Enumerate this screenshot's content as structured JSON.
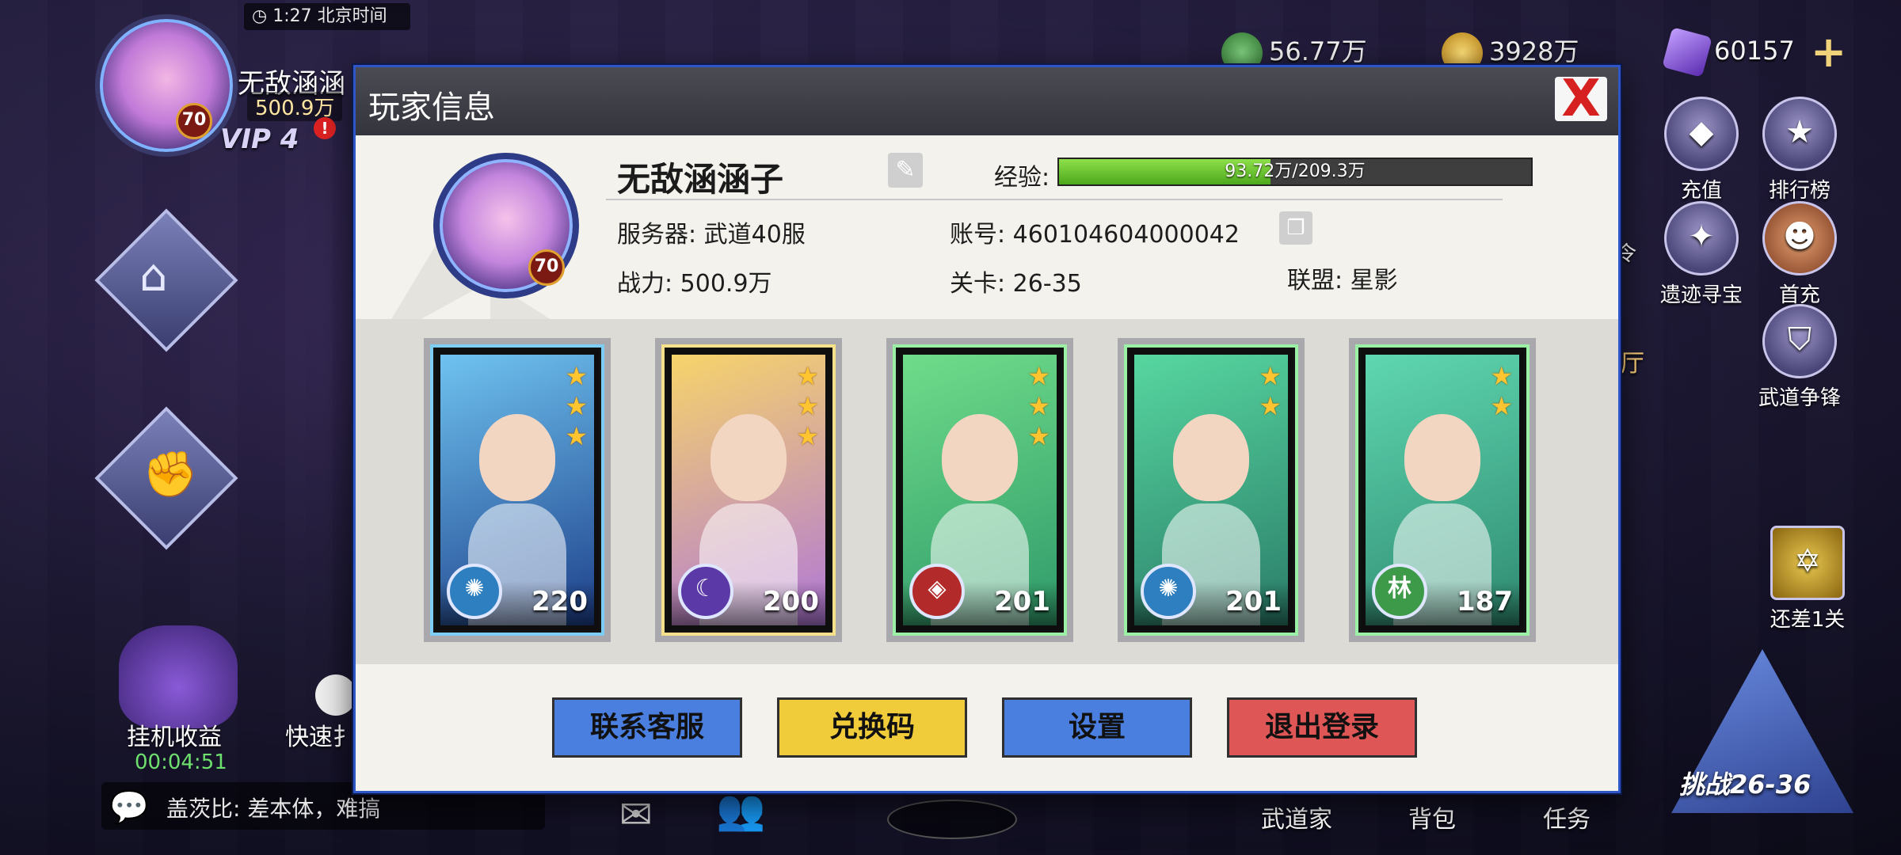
{
  "hud": {
    "time": "1:27 北京时间",
    "player_name": "无敌涵涵",
    "power": "500.9万",
    "level": "70",
    "vip": "VIP 4",
    "alert": "!",
    "currencies": [
      {
        "icon": "spiral-coin-icon",
        "value": "56.77万",
        "color": "#4aa04a"
      },
      {
        "icon": "gold-coin-icon",
        "value": "3928万",
        "color": "#d9a020"
      },
      {
        "icon": "purple-gem-icon",
        "value": "60157",
        "color": "#8a5ad8"
      }
    ],
    "add": "+",
    "right_buttons": [
      "充值",
      "排行榜",
      "遗迹寻宝",
      "首充",
      "武道争锋",
      "还差1关"
    ],
    "partial_left_labels": [
      "令",
      "厅"
    ],
    "left_bottom": {
      "idle": "挂机收益",
      "idle_timer": "00:04:51",
      "quick": "快速扌"
    },
    "chat": {
      "speaker": "盖茨比",
      "message": "差本体，难搞",
      "line": "盖茨比: 差本体，难搞"
    },
    "bottom_nav": [
      "武道家",
      "背包",
      "任务"
    ],
    "challenge": "挑战26-36"
  },
  "modal": {
    "title": "玩家信息",
    "close": "X",
    "player": {
      "name": "无敌涵涵子",
      "level": "70",
      "exp_label": "经验:",
      "exp_text": "93.72万/209.3万",
      "exp_fraction": 0.448,
      "server_label": "服务器:",
      "server": "武道40服",
      "account_label": "账号:",
      "account": "460104604000042",
      "power_label": "战力:",
      "power": "500.9万",
      "stage_label": "关卡:",
      "stage": "26-35",
      "alliance_label": "联盟:",
      "alliance": "星影"
    },
    "team": [
      {
        "level": "220",
        "stars": 3,
        "element": "wind-swirl-icon",
        "element_glyph": "✺",
        "element_color": "#2e7fc0",
        "bg": [
          "#6fc3f0",
          "#1d3f8a"
        ],
        "frame": "blue"
      },
      {
        "level": "200",
        "stars": 3,
        "element": "moon-icon",
        "element_glyph": "☾",
        "element_color": "#5b3aa8",
        "bg": [
          "#f7d46a",
          "#b077d8"
        ],
        "frame": "gold"
      },
      {
        "level": "201",
        "stars": 3,
        "element": "fire-icon",
        "element_glyph": "◈",
        "element_color": "#b22a2a",
        "bg": [
          "#6fdc8a",
          "#2f9a6a"
        ],
        "frame": "green"
      },
      {
        "level": "201",
        "stars": 2,
        "element": "wind-swirl-icon",
        "element_glyph": "✺",
        "element_color": "#2e7fc0",
        "bg": [
          "#57d7a0",
          "#2a7c68"
        ],
        "frame": "green"
      },
      {
        "level": "187",
        "stars": 2,
        "element": "forest-icon",
        "element_glyph": "林",
        "element_color": "#3c9a48",
        "bg": [
          "#5fd7b0",
          "#2f8a70"
        ],
        "frame": "green"
      }
    ],
    "buttons": [
      {
        "label": "联系客服",
        "color": "#4a7fe0",
        "text_color": "#111111"
      },
      {
        "label": "兑换码",
        "color": "#f1cc3a",
        "text_color": "#111111"
      },
      {
        "label": "设置",
        "color": "#4a7fe0",
        "text_color": "#111111"
      },
      {
        "label": "退出登录",
        "color": "#de5656",
        "text_color": "#111111"
      }
    ]
  }
}
